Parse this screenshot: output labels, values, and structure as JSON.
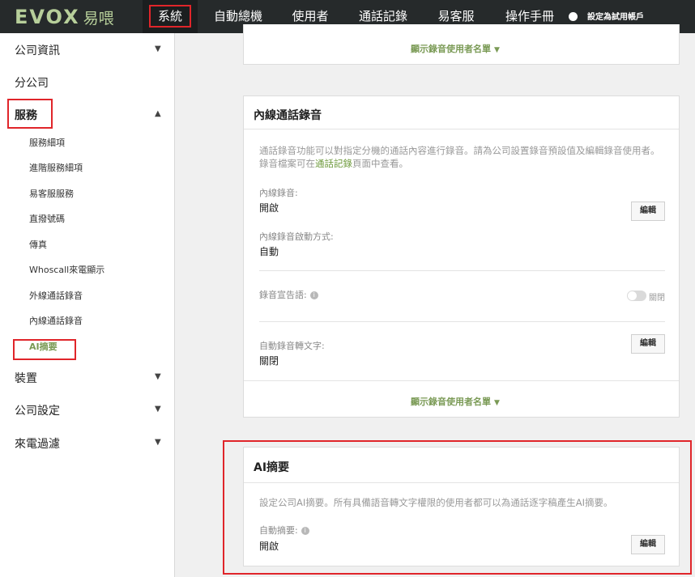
{
  "brand": {
    "logo_latin": "EVOX",
    "logo_cjk": "易喂"
  },
  "topnav": {
    "items": [
      "系統",
      "自動總機",
      "使用者",
      "通話記錄",
      "易客服",
      "操作手冊"
    ],
    "trial_label": "設定為試用帳戶"
  },
  "sidebar": {
    "company_info": "公司資訊",
    "branch": "分公司",
    "service": "服務",
    "service_subitems": [
      "服務細項",
      "進階服務細項",
      "易客服服務",
      "直撥號碼",
      "傳真",
      "Whoscall來電顯示",
      "外線通話錄音",
      "內線通話錄音",
      "AI摘要"
    ],
    "device": "裝置",
    "company_settings": "公司設定",
    "call_filter": "來電過濾"
  },
  "top_card": {
    "show_users_link": "顯示錄音使用者名單"
  },
  "internal_recording": {
    "title": "內線通話錄音",
    "desc_part1": "通話錄音功能可以對指定分機的通話內容進行錄音。請為公司設置錄音預設值及編輯錄音使用者。錄音檔案可在",
    "desc_link": "通話記錄",
    "desc_part2": "頁面中查看。",
    "recording_label": "內線錄音:",
    "recording_value": "開啟",
    "trigger_label": "內線錄音啟動方式:",
    "trigger_value": "自動",
    "announce_label": "錄音宣告語:",
    "announce_state": "關閉",
    "transcribe_label": "自動錄音轉文字:",
    "transcribe_value": "關閉",
    "edit_label": "編輯",
    "show_users_link": "顯示錄音使用者名單"
  },
  "ai_summary": {
    "title": "AI摘要",
    "desc": "設定公司AI摘要。所有具備語音轉文字權限的使用者都可以為通話逐字稿產生AI摘要。",
    "auto_label": "自動摘要:",
    "auto_value": "開啟",
    "edit_label": "編輯"
  },
  "icons": {
    "chevron_down": "chevron-down-icon",
    "chevron_up": "chevron-up-icon",
    "info": "info-icon",
    "triangle_down": "triangle-down-icon"
  },
  "colors": {
    "nav_bg": "#262a2b",
    "brand_green": "#b7cf9a",
    "link_green": "#7a9a55",
    "highlight_red": "#e0252a"
  }
}
